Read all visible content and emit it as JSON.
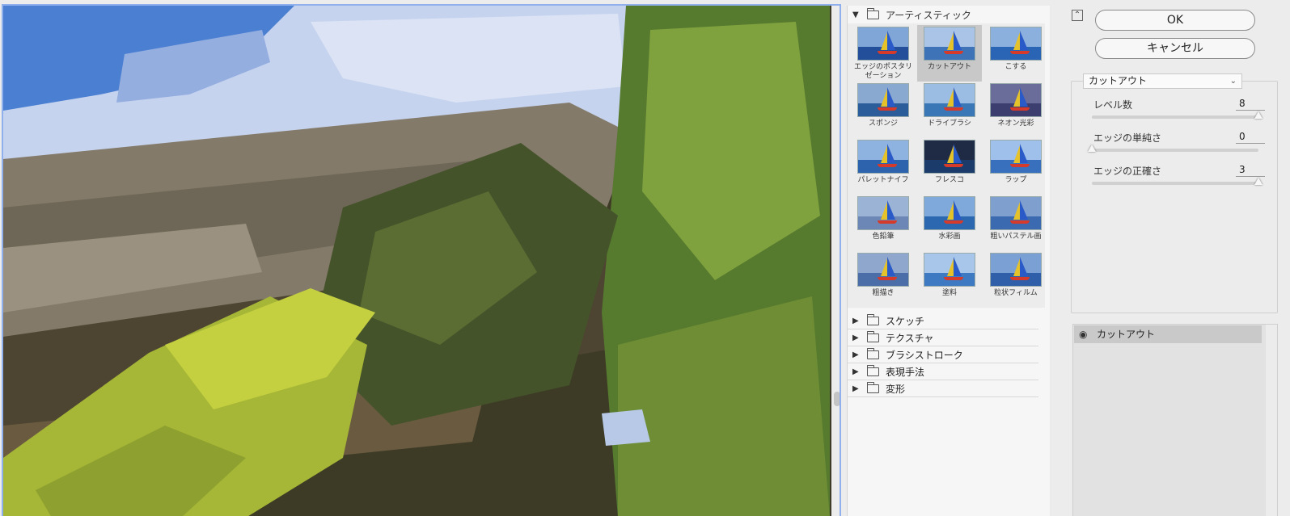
{
  "colors": {
    "preview_border": "#8fb0ec",
    "selected_thumb": "#c8c8c8"
  },
  "gallery": {
    "open_category": "アーティスティック",
    "filters": [
      {
        "label": "エッジのポスタリゼーション",
        "selected": false,
        "sky": "#7fa6d6",
        "sea": "#234f9a"
      },
      {
        "label": "カットアウト",
        "selected": true,
        "sky": "#a9c4e6",
        "sea": "#3f73b8"
      },
      {
        "label": "こする",
        "selected": false,
        "sky": "#8cb0de",
        "sea": "#2a64b4"
      },
      {
        "label": "スポンジ",
        "selected": false,
        "sky": "#89a9d1",
        "sea": "#2a5d9a"
      },
      {
        "label": "ドライブラシ",
        "selected": false,
        "sky": "#9cbde3",
        "sea": "#3a77b7"
      },
      {
        "label": "ネオン光彩",
        "selected": false,
        "sky": "#6a6c9a",
        "sea": "#3b3e6e"
      },
      {
        "label": "パレットナイフ",
        "selected": false,
        "sky": "#8fb3e0",
        "sea": "#2d63ad"
      },
      {
        "label": "フレスコ",
        "selected": false,
        "sky": "#1f2a44",
        "sea": "#1b3c6a"
      },
      {
        "label": "ラップ",
        "selected": false,
        "sky": "#9ec0ea",
        "sea": "#3870be"
      },
      {
        "label": "色鉛筆",
        "selected": false,
        "sky": "#9bb4d6",
        "sea": "#6c86b5"
      },
      {
        "label": "水彩画",
        "selected": false,
        "sky": "#7ea9da",
        "sea": "#2c68b0"
      },
      {
        "label": "粗いパステル画",
        "selected": false,
        "sky": "#7f9fcf",
        "sea": "#3b6ab0"
      },
      {
        "label": "粗描き",
        "selected": false,
        "sky": "#8fa7cc",
        "sea": "#4b6ea8"
      },
      {
        "label": "塗料",
        "selected": false,
        "sky": "#a7c6ea",
        "sea": "#3d7ac2"
      },
      {
        "label": "粒状フィルム",
        "selected": false,
        "sky": "#7aa0d4",
        "sea": "#2f5fa8"
      }
    ],
    "categories": [
      "スケッチ",
      "テクスチャ",
      "ブラシストローク",
      "表現手法",
      "変形"
    ]
  },
  "settings": {
    "ok_label": "OK",
    "cancel_label": "キャンセル",
    "collapse_icon": "collapse-up-icon",
    "selected_filter": "カットアウト",
    "params": [
      {
        "label": "レベル数",
        "value": "8",
        "fraction": 1.0
      },
      {
        "label": "エッジの単純さ",
        "value": "0",
        "fraction": 0.0
      },
      {
        "label": "エッジの正確さ",
        "value": "3",
        "fraction": 1.0
      }
    ]
  },
  "layers": {
    "items": [
      {
        "name": "カットアウト",
        "visible": true
      }
    ]
  }
}
